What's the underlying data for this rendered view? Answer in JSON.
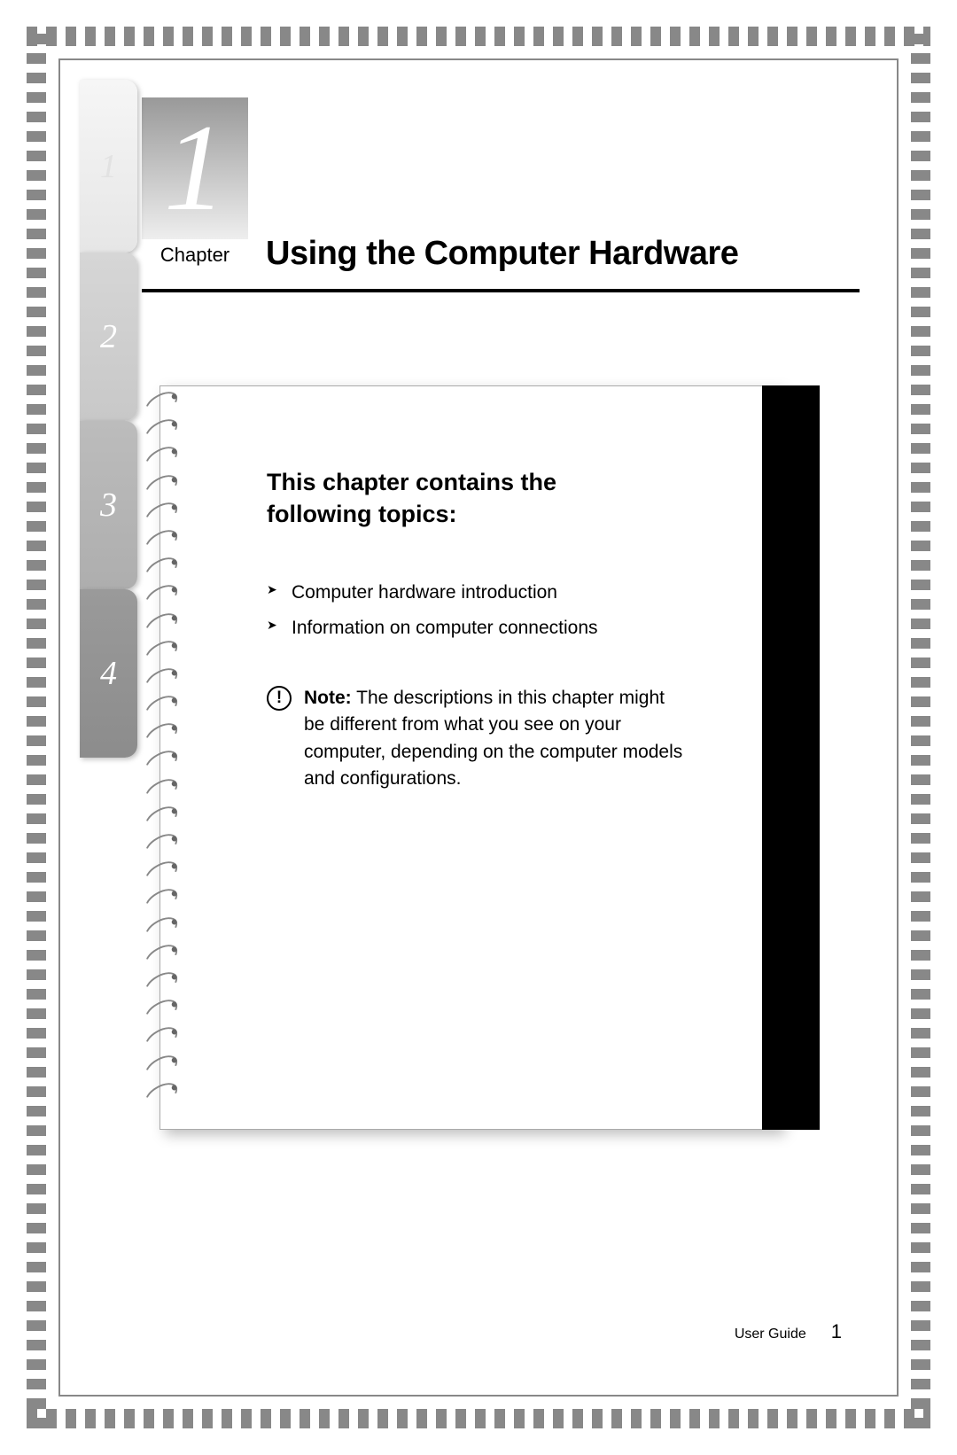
{
  "chapter": {
    "number": "1",
    "label": "Chapter",
    "title": "Using the Computer Hardware"
  },
  "topics": {
    "heading": "This chapter contains the following topics:",
    "items": [
      "Computer hardware introduction",
      "Information on computer connections"
    ]
  },
  "note": {
    "label": "Note:",
    "text": "The descriptions in this chapter might be different from what you see on your computer, depending on the computer models and configurations."
  },
  "tabs": [
    "1",
    "2",
    "3",
    "4"
  ],
  "footer": {
    "guide": "User Guide",
    "page": "1"
  }
}
